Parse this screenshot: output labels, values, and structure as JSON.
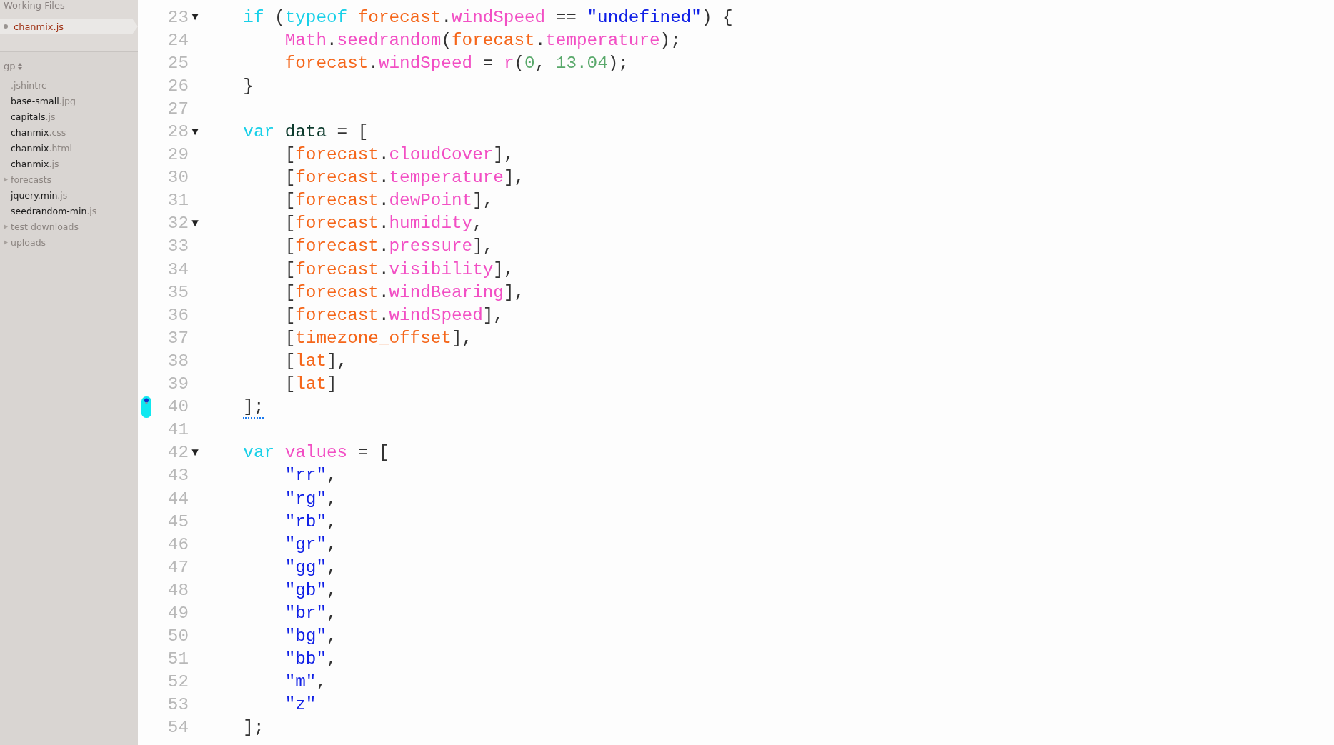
{
  "sidebar": {
    "working_files": {
      "title": "Working Files",
      "files": [
        {
          "name": "chanmix",
          "ext": ".js",
          "selected": true
        }
      ]
    },
    "project": {
      "name": "gp"
    },
    "tree": [
      {
        "kind": "dotfile",
        "name": ".jshintrc"
      },
      {
        "kind": "file",
        "name": "base-small",
        "ext": ".jpg"
      },
      {
        "kind": "file",
        "name": "capitals",
        "ext": ".js"
      },
      {
        "kind": "file",
        "name": "chanmix",
        "ext": ".css"
      },
      {
        "kind": "file",
        "name": "chanmix",
        "ext": ".html"
      },
      {
        "kind": "file",
        "name": "chanmix",
        "ext": ".js"
      },
      {
        "kind": "folder",
        "name": "forecasts",
        "expanded": false
      },
      {
        "kind": "file",
        "name": "jquery.min",
        "ext": ".js"
      },
      {
        "kind": "file",
        "name": "seedrandom-min",
        "ext": ".js"
      },
      {
        "kind": "folder",
        "name": "test downloads",
        "expanded": false
      },
      {
        "kind": "folder",
        "name": "uploads",
        "expanded": false
      }
    ]
  },
  "editor": {
    "lines": [
      {
        "number": "23",
        "fold": "▼",
        "code": [
          {
            "kind": "kw",
            "text": "    if"
          },
          {
            "kind": "plain",
            "text": " ("
          },
          {
            "kind": "kw",
            "text": "typeof"
          },
          {
            "kind": "var",
            "text": " forecast"
          },
          {
            "kind": "plain",
            "text": "."
          },
          {
            "kind": "prop",
            "text": "windSpeed"
          },
          {
            "kind": "plain",
            "text": " == "
          },
          {
            "kind": "str",
            "text": "\"undefined\""
          },
          {
            "kind": "plain",
            "text": ") {"
          }
        ]
      },
      {
        "number": "24",
        "code": [
          {
            "kind": "prop",
            "text": "        Math"
          },
          {
            "kind": "plain",
            "text": "."
          },
          {
            "kind": "prop",
            "text": "seedrandom"
          },
          {
            "kind": "plain",
            "text": "("
          },
          {
            "kind": "var",
            "text": "forecast"
          },
          {
            "kind": "plain",
            "text": "."
          },
          {
            "kind": "prop",
            "text": "temperature"
          },
          {
            "kind": "plain",
            "text": ");"
          }
        ]
      },
      {
        "number": "25",
        "code": [
          {
            "kind": "var",
            "text": "        forecast"
          },
          {
            "kind": "plain",
            "text": "."
          },
          {
            "kind": "prop",
            "text": "windSpeed"
          },
          {
            "kind": "plain",
            "text": " = "
          },
          {
            "kind": "prop",
            "text": "r"
          },
          {
            "kind": "plain",
            "text": "("
          },
          {
            "kind": "num",
            "text": "0"
          },
          {
            "kind": "plain",
            "text": ", "
          },
          {
            "kind": "num",
            "text": "13.04"
          },
          {
            "kind": "plain",
            "text": ");"
          }
        ]
      },
      {
        "number": "26",
        "code": [
          {
            "kind": "plain",
            "text": "    }"
          }
        ]
      },
      {
        "number": "27"
      },
      {
        "number": "28",
        "fold": "▼",
        "code": [
          {
            "kind": "kw",
            "text": "    var"
          },
          {
            "kind": "def",
            "text": " data"
          },
          {
            "kind": "plain",
            "text": " = ["
          }
        ]
      },
      {
        "number": "29",
        "code": [
          {
            "kind": "plain",
            "text": "        ["
          },
          {
            "kind": "var",
            "text": "forecast"
          },
          {
            "kind": "plain",
            "text": "."
          },
          {
            "kind": "prop",
            "text": "cloudCover"
          },
          {
            "kind": "plain",
            "text": "],"
          }
        ]
      },
      {
        "number": "30",
        "code": [
          {
            "kind": "plain",
            "text": "        ["
          },
          {
            "kind": "var",
            "text": "forecast"
          },
          {
            "kind": "plain",
            "text": "."
          },
          {
            "kind": "prop",
            "text": "temperature"
          },
          {
            "kind": "plain",
            "text": "],"
          }
        ]
      },
      {
        "number": "31",
        "code": [
          {
            "kind": "plain",
            "text": "        ["
          },
          {
            "kind": "var",
            "text": "forecast"
          },
          {
            "kind": "plain",
            "text": "."
          },
          {
            "kind": "prop",
            "text": "dewPoint"
          },
          {
            "kind": "plain",
            "text": "],"
          }
        ]
      },
      {
        "number": "32",
        "fold": "▼",
        "code": [
          {
            "kind": "plain",
            "text": "        ["
          },
          {
            "kind": "var",
            "text": "forecast"
          },
          {
            "kind": "plain",
            "text": "."
          },
          {
            "kind": "prop",
            "text": "humidity"
          },
          {
            "kind": "plain",
            "text": ","
          }
        ]
      },
      {
        "number": "33",
        "code": [
          {
            "kind": "plain",
            "text": "        ["
          },
          {
            "kind": "var",
            "text": "forecast"
          },
          {
            "kind": "plain",
            "text": "."
          },
          {
            "kind": "prop",
            "text": "pressure"
          },
          {
            "kind": "plain",
            "text": "],"
          }
        ]
      },
      {
        "number": "34",
        "code": [
          {
            "kind": "plain",
            "text": "        ["
          },
          {
            "kind": "var",
            "text": "forecast"
          },
          {
            "kind": "plain",
            "text": "."
          },
          {
            "kind": "prop",
            "text": "visibility"
          },
          {
            "kind": "plain",
            "text": "],"
          }
        ]
      },
      {
        "number": "35",
        "code": [
          {
            "kind": "plain",
            "text": "        ["
          },
          {
            "kind": "var",
            "text": "forecast"
          },
          {
            "kind": "plain",
            "text": "."
          },
          {
            "kind": "prop",
            "text": "windBearing"
          },
          {
            "kind": "plain",
            "text": "],"
          }
        ]
      },
      {
        "number": "36",
        "code": [
          {
            "kind": "plain",
            "text": "        ["
          },
          {
            "kind": "var",
            "text": "forecast"
          },
          {
            "kind": "plain",
            "text": "."
          },
          {
            "kind": "prop",
            "text": "windSpeed"
          },
          {
            "kind": "plain",
            "text": "],"
          }
        ]
      },
      {
        "number": "37",
        "code": [
          {
            "kind": "plain",
            "text": "        ["
          },
          {
            "kind": "var",
            "text": "timezone_offset"
          },
          {
            "kind": "plain",
            "text": "],"
          }
        ]
      },
      {
        "number": "38",
        "code": [
          {
            "kind": "plain",
            "text": "        ["
          },
          {
            "kind": "var",
            "text": "lat"
          },
          {
            "kind": "plain",
            "text": "],"
          }
        ]
      },
      {
        "number": "39",
        "code": [
          {
            "kind": "plain",
            "text": "        ["
          },
          {
            "kind": "var",
            "text": "lat"
          },
          {
            "kind": "plain",
            "text": "]"
          }
        ]
      },
      {
        "number": "40",
        "hint": true,
        "code": [
          {
            "kind": "plain",
            "text": "    ];"
          }
        ]
      },
      {
        "number": "41"
      },
      {
        "number": "42",
        "fold": "▼",
        "code": [
          {
            "kind": "kw",
            "text": "    var"
          },
          {
            "kind": "prop",
            "text": " values"
          },
          {
            "kind": "plain",
            "text": " = ["
          }
        ]
      },
      {
        "number": "43",
        "code": [
          {
            "kind": "str",
            "text": "        \"rr\""
          },
          {
            "kind": "plain",
            "text": ","
          }
        ]
      },
      {
        "number": "44",
        "code": [
          {
            "kind": "str",
            "text": "        \"rg\""
          },
          {
            "kind": "plain",
            "text": ","
          }
        ]
      },
      {
        "number": "45",
        "code": [
          {
            "kind": "str",
            "text": "        \"rb\""
          },
          {
            "kind": "plain",
            "text": ","
          }
        ]
      },
      {
        "number": "46",
        "code": [
          {
            "kind": "str",
            "text": "        \"gr\""
          },
          {
            "kind": "plain",
            "text": ","
          }
        ]
      },
      {
        "number": "47",
        "code": [
          {
            "kind": "str",
            "text": "        \"gg\""
          },
          {
            "kind": "plain",
            "text": ","
          }
        ]
      },
      {
        "number": "48",
        "code": [
          {
            "kind": "str",
            "text": "        \"gb\""
          },
          {
            "kind": "plain",
            "text": ","
          }
        ]
      },
      {
        "number": "49",
        "code": [
          {
            "kind": "str",
            "text": "        \"br\""
          },
          {
            "kind": "plain",
            "text": ","
          }
        ]
      },
      {
        "number": "50",
        "code": [
          {
            "kind": "str",
            "text": "        \"bg\""
          },
          {
            "kind": "plain",
            "text": ","
          }
        ]
      },
      {
        "number": "51",
        "code": [
          {
            "kind": "str",
            "text": "        \"bb\""
          },
          {
            "kind": "plain",
            "text": ","
          }
        ]
      },
      {
        "number": "52",
        "code": [
          {
            "kind": "str",
            "text": "        \"m\""
          },
          {
            "kind": "plain",
            "text": ","
          }
        ]
      },
      {
        "number": "53",
        "code": [
          {
            "kind": "str",
            "text": "        \"z\""
          }
        ]
      },
      {
        "number": "54",
        "code": [
          {
            "kind": "plain",
            "text": "    ];"
          }
        ]
      }
    ]
  }
}
